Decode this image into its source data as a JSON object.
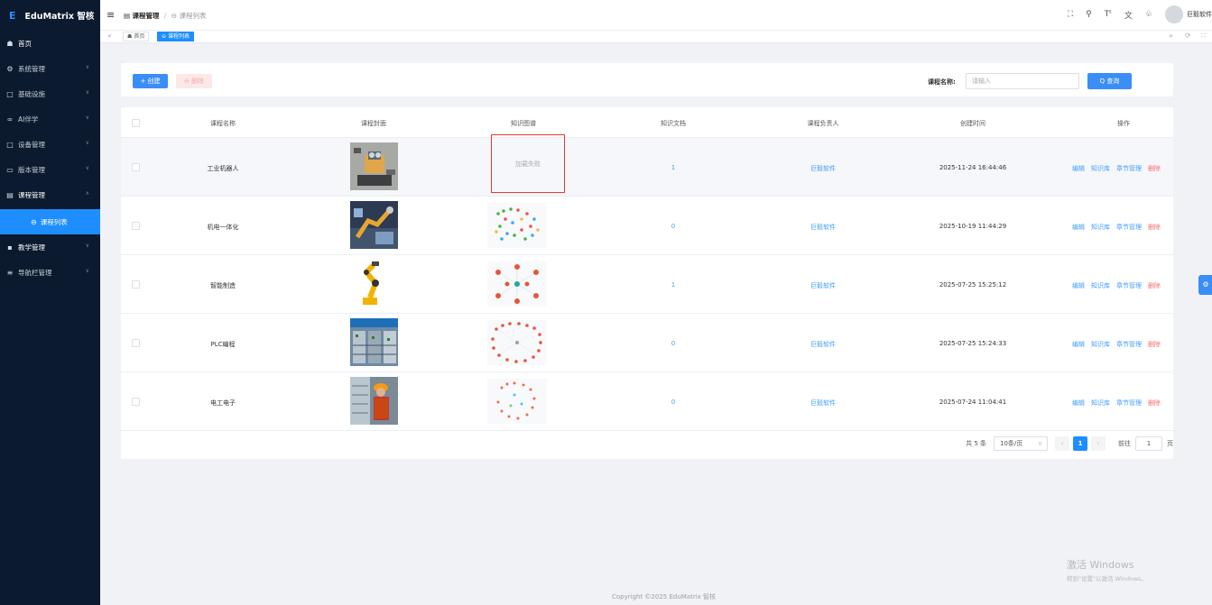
{
  "app": {
    "logo_text": "EduMatrix 智核",
    "logo_icon": "E"
  },
  "sidebar": {
    "items": [
      {
        "label": "首页",
        "icon": "home-icon"
      },
      {
        "label": "系统管理",
        "icon": "gear-icon"
      },
      {
        "label": "基础设施",
        "icon": "monitor-icon"
      },
      {
        "label": "AI伴学",
        "icon": "ai-icon"
      },
      {
        "label": "设备管理",
        "icon": "monitor-icon"
      },
      {
        "label": "版本管理",
        "icon": "folder-icon"
      },
      {
        "label": "课程管理",
        "icon": "calendar-icon"
      },
      {
        "label": "教学管理",
        "icon": "book-icon"
      },
      {
        "label": "导航栏管理",
        "icon": "menu-icon"
      }
    ],
    "sub_item": {
      "label": "课程列表"
    }
  },
  "header": {
    "breadcrumb_parent": "课程管理",
    "breadcrumb_sep": "/",
    "breadcrumb_current": "课程列表",
    "user_name": "巨毅软件"
  },
  "tags": {
    "home": "首页",
    "current": "课程列表"
  },
  "toolbar": {
    "create_label": "+ 创建",
    "delete_label": "⊖ 删除",
    "query_label": "课程名称:",
    "query_placeholder": "请输入",
    "query_button": "Q 查询"
  },
  "table": {
    "headers": [
      "课程名称",
      "课程封面",
      "知识图谱",
      "知识文档",
      "课程负责人",
      "创建时间",
      "操作"
    ],
    "ops": [
      "编辑",
      "知识库",
      "章节管理",
      "删除"
    ],
    "load_failed": "加载失败",
    "rows": [
      {
        "name": "工业机器人",
        "docs": "1",
        "owner": "巨毅软件",
        "created": "2025-11-24 16:44:46",
        "graph": "failed"
      },
      {
        "name": "机电一体化",
        "docs": "0",
        "owner": "巨毅软件",
        "created": "2025-10-19 11:44:29",
        "graph": "graph-a"
      },
      {
        "name": "智能制造",
        "docs": "1",
        "owner": "巨毅软件",
        "created": "2025-07-25 15:25:12",
        "graph": "graph-b"
      },
      {
        "name": "PLC编程",
        "docs": "0",
        "owner": "巨毅软件",
        "created": "2025-07-25 15:24:33",
        "graph": "graph-c"
      },
      {
        "name": "电工电子",
        "docs": "0",
        "owner": "巨毅软件",
        "created": "2025-07-24 11:04:41",
        "graph": "graph-d"
      }
    ]
  },
  "pagination": {
    "total": "共 5 条",
    "page_size": "10条/页",
    "current": "1",
    "goto_label": "前往",
    "goto_value": "1",
    "page_unit": "页"
  },
  "footer": {
    "copyright": "Copyright ©2025 EduMatrix 智核"
  },
  "watermark": {
    "line1": "激活 Windows",
    "line2": "转到\"设置\"以激活 Windows。"
  },
  "colors": {
    "sidebar_bg": "#0b1a2e",
    "primary": "#1e8eff",
    "danger": "#f56c6c",
    "link": "#409eff"
  }
}
